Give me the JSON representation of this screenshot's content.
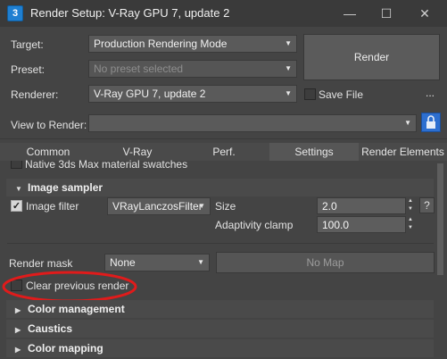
{
  "window": {
    "icon_text": "3",
    "title": "Render Setup: V-Ray GPU 7, update 2",
    "minimize": "—",
    "maximize": "☐",
    "close": "✕"
  },
  "header": {
    "target_label": "Target:",
    "target_value": "Production Rendering Mode",
    "preset_label": "Preset:",
    "preset_placeholder": "No preset selected",
    "renderer_label": "Renderer:",
    "renderer_value": "V-Ray GPU 7, update 2",
    "render_button": "Render",
    "save_file_label": "Save File",
    "ellipsis": "...",
    "view_label": "View to Render:",
    "view_value": ""
  },
  "tabs": [
    {
      "label": "Common",
      "active": false
    },
    {
      "label": "V-Ray",
      "active": false
    },
    {
      "label": "Perf.",
      "active": false
    },
    {
      "label": "Settings",
      "active": true
    },
    {
      "label": "Render Elements",
      "active": false
    }
  ],
  "panel": {
    "native_swatches_label": "Native 3ds Max material swatches",
    "image_sampler": {
      "title": "Image sampler",
      "image_filter_label": "Image filter",
      "image_filter_checked": true,
      "filter_value": "VRayLanczosFilter",
      "size_label": "Size",
      "size_value": "2.0",
      "help": "?",
      "adaptivity_label": "Adaptivity clamp",
      "adaptivity_value": "100.0",
      "render_mask_label": "Render mask",
      "render_mask_value": "None",
      "no_map_label": "No Map",
      "clear_previous_label": "Clear previous render",
      "clear_previous_checked": false
    },
    "collapsed_rollouts": [
      "Color management",
      "Caustics",
      "Color mapping"
    ]
  },
  "colors": {
    "annotation_circle": "#e01b1b",
    "lock_button": "#2d6fd0",
    "window_bg": "#444444"
  }
}
